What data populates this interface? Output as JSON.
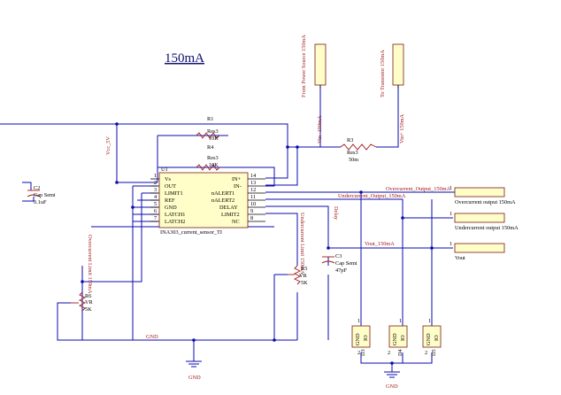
{
  "title": "150mA",
  "ports": {
    "from_power_source": "From Power Source 150mA",
    "to_transistor": "To Transistor 150mA",
    "vin_minus": "Vin- 150mA",
    "vin_plus": "Vin+ 150mA",
    "overcurrent_output": "Overcurrent output 150mA",
    "undercurrent_output": "Undercurrent output 150mA",
    "vout": "Vout"
  },
  "nets": {
    "vcc": "Vcc_5V",
    "overcurrent_output": "Overcurrent_Output_150mA",
    "undercurrent_output": "Undercurrent_Output_150mA",
    "vout": "Vout_150mA",
    "delay": "Delay",
    "gnd": "GND",
    "gnd2": "GND",
    "overcurrent_limit": "Overcurrent Limit 150mA",
    "undercurrent_limit": "Undercurrent Limit 150mA"
  },
  "ic": {
    "ref": "U1",
    "name": "INA303_current_sensor_TI",
    "left_pins": [
      {
        "name": "Vs",
        "num": "1"
      },
      {
        "name": "OUT",
        "num": "2"
      },
      {
        "name": "LIMIT1",
        "num": "3"
      },
      {
        "name": "REF",
        "num": "4"
      },
      {
        "name": "GND",
        "num": "5"
      },
      {
        "name": "LATCH1",
        "num": "6"
      },
      {
        "name": "LATCH2",
        "num": "7"
      }
    ],
    "right_pins": [
      {
        "name": "IN+",
        "num": "14"
      },
      {
        "name": "IN-",
        "num": "13"
      },
      {
        "name": "nALERT1",
        "num": "12"
      },
      {
        "name": "nALERT2",
        "num": "11"
      },
      {
        "name": "DELAY",
        "num": "10"
      },
      {
        "name": "LIMIT2",
        "num": "9"
      },
      {
        "name": "NC",
        "num": "8"
      }
    ]
  },
  "resistors": {
    "r1": {
      "ref": "R1",
      "type": "Res3",
      "value": "10K"
    },
    "r4": {
      "ref": "R4",
      "type": "Res3",
      "value": "10K"
    },
    "r3": {
      "ref": "R3",
      "type": "Res3",
      "value": "50m"
    },
    "r6": {
      "ref": "R6",
      "type": "VR",
      "value": "5K"
    },
    "r5": {
      "ref": "R5",
      "type": "VR",
      "value": "5K"
    }
  },
  "capacitors": {
    "c2": {
      "ref": "C2",
      "type": "Cap Semi",
      "value": "0.1uF"
    },
    "c3": {
      "ref": "C3",
      "type": "Cap Semi",
      "value": "47pF"
    }
  },
  "connectors": [
    {
      "ref": "D3",
      "pin_gnd": "GND",
      "pin_io": "IO",
      "num_top": "1",
      "num_bottom": "2"
    },
    {
      "ref": "D4",
      "pin_gnd": "GND",
      "pin_io": "IO",
      "num_top": "1",
      "num_bottom": "2"
    },
    {
      "ref": "D5",
      "pin_gnd": "GND",
      "pin_io": "IO",
      "num_top": "1",
      "num_bottom": "2"
    }
  ],
  "pin_numbers": {
    "one": "1"
  },
  "gnd_labels": {
    "left": "GND",
    "right": "GND"
  },
  "colors": {
    "wire": "#0b0bb2",
    "component_fill": "#fffdc8",
    "component_border": "#7a1a1a",
    "label_red": "#a01818",
    "title": "#101070"
  }
}
